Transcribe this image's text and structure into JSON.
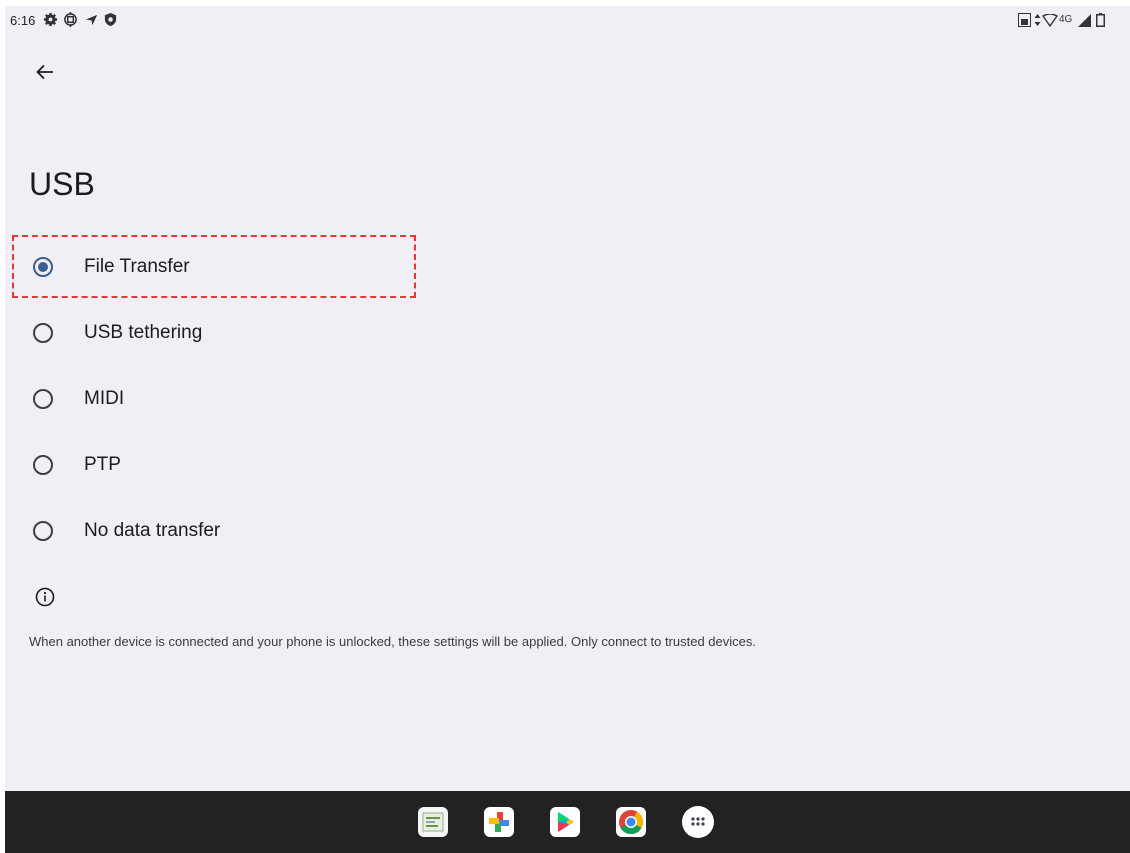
{
  "status_bar": {
    "time": "6:16",
    "network_label": "4G",
    "left_icons": [
      "settings-gear-icon",
      "vpn-icon",
      "location-arrow-icon",
      "shield-icon"
    ],
    "right_icons": [
      "sim-card-icon",
      "data-arrows-icon",
      "wifi-icon",
      "cellular-signal-icon",
      "battery-icon"
    ]
  },
  "header": {
    "back_icon": "arrow-left-icon",
    "title": "USB"
  },
  "options": [
    {
      "label": "File Transfer",
      "selected": true
    },
    {
      "label": "USB tethering",
      "selected": false
    },
    {
      "label": "MIDI",
      "selected": false
    },
    {
      "label": "PTP",
      "selected": false
    },
    {
      "label": "No data transfer",
      "selected": false
    }
  ],
  "info": {
    "icon": "info-icon",
    "text": "When another device is connected and your phone is unlocked, these settings will be applied. Only connect to trusted devices."
  },
  "taskbar": {
    "apps": [
      "sheets-app-icon",
      "photos-app-icon",
      "play-store-icon",
      "chrome-icon",
      "app-drawer-icon"
    ]
  },
  "colors": {
    "background": "#f0eff5",
    "accent": "#3c5f8f",
    "taskbar": "#222222",
    "highlight": "#e53935"
  }
}
